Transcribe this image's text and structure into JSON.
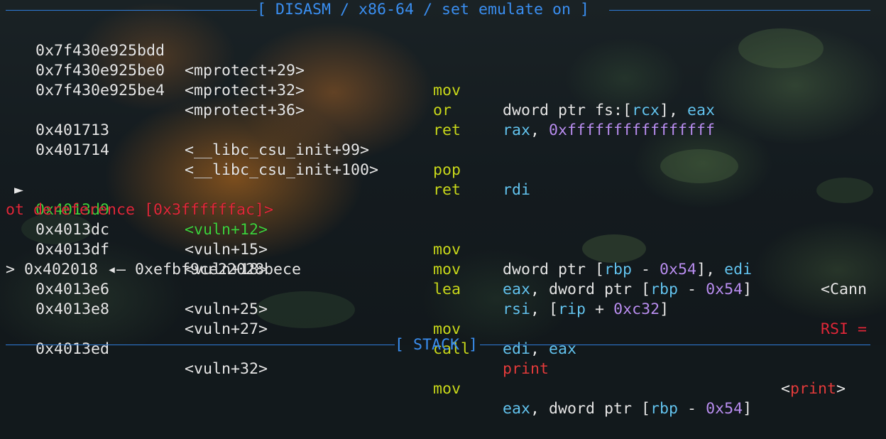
{
  "header": {
    "title": "[ DISASM / x86-64 / set emulate on ]",
    "next_section_title": "[ STACK ]"
  },
  "colors": {
    "rule": "#2f7cd9",
    "address": "#e6e6e6",
    "current_address": "#3ed13e",
    "mnemonic": "#c8d81c",
    "register": "#63c3ee",
    "immediate": "#b98ef0",
    "function": "#e23c3c",
    "error": "#e0283a"
  },
  "current_marker": "►",
  "rows": [
    {
      "addr": "0x7f430e925bdd",
      "sym": "<mprotect+29>",
      "mn": "mov",
      "op": [
        "dword ptr fs:[",
        "rcx",
        "], ",
        "eax"
      ]
    },
    {
      "addr": "0x7f430e925be0",
      "sym": "<mprotect+32>",
      "mn": "or",
      "op": [
        "rax",
        ", ",
        "0xffffffffffffffff"
      ]
    },
    {
      "addr": "0x7f430e925be4",
      "sym": "<mprotect+36>",
      "mn": "ret"
    },
    {
      "addr": "0x401713",
      "sym": "<__libc_csu_init+99>",
      "mn": "pop",
      "op": [
        "rdi"
      ]
    },
    {
      "addr": "0x401714",
      "sym": "<__libc_csu_init+100>",
      "mn": "ret"
    },
    {
      "addr": "0x4013d9",
      "sym": "<vuln+12>",
      "mn": "mov",
      "op": [
        "dword ptr [",
        "rbp",
        " - ",
        "0x54",
        "], ",
        "edi"
      ],
      "annot_a": "<Cann",
      "annot_b": "ot dereference [0x3ffffffac]>"
    },
    {
      "addr": "0x4013dc",
      "sym": "<vuln+15>",
      "mn": "mov",
      "op": [
        "eax",
        ", dword ptr [",
        "rbp",
        " - ",
        "0x54",
        "]"
      ]
    },
    {
      "addr": "0x4013df",
      "sym": "<vuln+18>",
      "mn": "lea",
      "op": [
        "rsi",
        ", [",
        "rip",
        " + ",
        "0xc32",
        "]"
      ],
      "annot_a": "RSI =",
      "annot_b": "> 0x402018 ◂— 0xefbf9ce22028bece"
    },
    {
      "addr": "0x4013e6",
      "sym": "<vuln+25>",
      "mn": "mov",
      "op": [
        "edi",
        ", ",
        "eax"
      ]
    },
    {
      "addr": "0x4013e8",
      "sym": "<vuln+27>",
      "mn": "call",
      "op": [
        "print"
      ],
      "annot": [
        "<",
        "print",
        ">"
      ]
    },
    {
      "addr": "0x4013ed",
      "sym": "<vuln+32>",
      "mn": "mov",
      "op": [
        "eax",
        ", dword ptr [",
        "rbp",
        " - ",
        "0x54",
        "]"
      ]
    }
  ]
}
